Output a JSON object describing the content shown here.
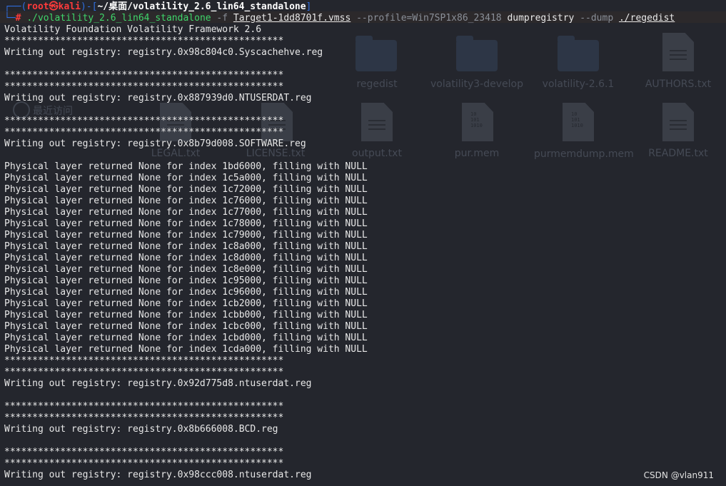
{
  "prompt": {
    "box_top": "┌──(",
    "user": "root",
    "at": "㉿",
    "host": "kali",
    "sep": ")-[",
    "path": "~/桌面/volatility_2.6_lin64_standalone",
    "close": "]",
    "box_bottom": "└─",
    "hash": "# "
  },
  "command": {
    "executable": "./volatility_2.6_lin64_standalone",
    "flag_f": "-f",
    "image_file": "Target1-1dd8701f.vmss",
    "profile_arg": "--profile=Win7SP1x86_23418",
    "plugin": "dumpregistry",
    "flag_dump": "--dump",
    "dump_dir": "./regedist"
  },
  "output_lines": [
    "Volatility Foundation Volatility Framework 2.6",
    "**************************************************",
    "Writing out registry: registry.0x98c804c0.Syscachehve.reg",
    "",
    "**************************************************",
    "**************************************************",
    "Writing out registry: registry.0x887939d0.NTUSERDAT.reg",
    "",
    "**************************************************",
    "**************************************************",
    "Writing out registry: registry.0x8b79d008.SOFTWARE.reg",
    "",
    "Physical layer returned None for index 1bd6000, filling with NULL",
    "Physical layer returned None for index 1c5a000, filling with NULL",
    "Physical layer returned None for index 1c72000, filling with NULL",
    "Physical layer returned None for index 1c76000, filling with NULL",
    "Physical layer returned None for index 1c77000, filling with NULL",
    "Physical layer returned None for index 1c78000, filling with NULL",
    "Physical layer returned None for index 1c79000, filling with NULL",
    "Physical layer returned None for index 1c8a000, filling with NULL",
    "Physical layer returned None for index 1c8d000, filling with NULL",
    "Physical layer returned None for index 1c8e000, filling with NULL",
    "Physical layer returned None for index 1c95000, filling with NULL",
    "Physical layer returned None for index 1c96000, filling with NULL",
    "Physical layer returned None for index 1cb2000, filling with NULL",
    "Physical layer returned None for index 1cbb000, filling with NULL",
    "Physical layer returned None for index 1cbc000, filling with NULL",
    "Physical layer returned None for index 1cbd000, filling with NULL",
    "Physical layer returned None for index 1cda000, filling with NULL",
    "**************************************************",
    "**************************************************",
    "Writing out registry: registry.0x92d775d8.ntuserdat.reg",
    "",
    "**************************************************",
    "**************************************************",
    "Writing out registry: registry.0x8b666008.BCD.reg",
    "",
    "**************************************************",
    "**************************************************",
    "Writing out registry: registry.0x98ccc008.ntuserdat.reg"
  ],
  "desktop": {
    "items": [
      {
        "label": "regedist",
        "kind": "folder"
      },
      {
        "label": "volatility3-develop",
        "kind": "folder"
      },
      {
        "label": "volatility-2.6.1",
        "kind": "folder"
      },
      {
        "label": "AUTHORS.txt",
        "kind": "file"
      },
      {
        "label": "LEGAL.txt",
        "kind": "file"
      },
      {
        "label": "LICENSE.txt",
        "kind": "file"
      },
      {
        "label": "output.txt",
        "kind": "file"
      },
      {
        "label": "pur.mem",
        "kind": "binary"
      },
      {
        "label": "purmemdump.mem",
        "kind": "binary"
      },
      {
        "label": "README.txt",
        "kind": "file"
      }
    ],
    "sidebar_recent": "最近访问"
  },
  "watermark": "CSDN @vlan911",
  "colors": {
    "background": "#24262d",
    "prompt_frame": "#2f6ee0",
    "prompt_user": "#ff3b3b",
    "command": "#3fd66b",
    "text": "#e8e8e8"
  }
}
